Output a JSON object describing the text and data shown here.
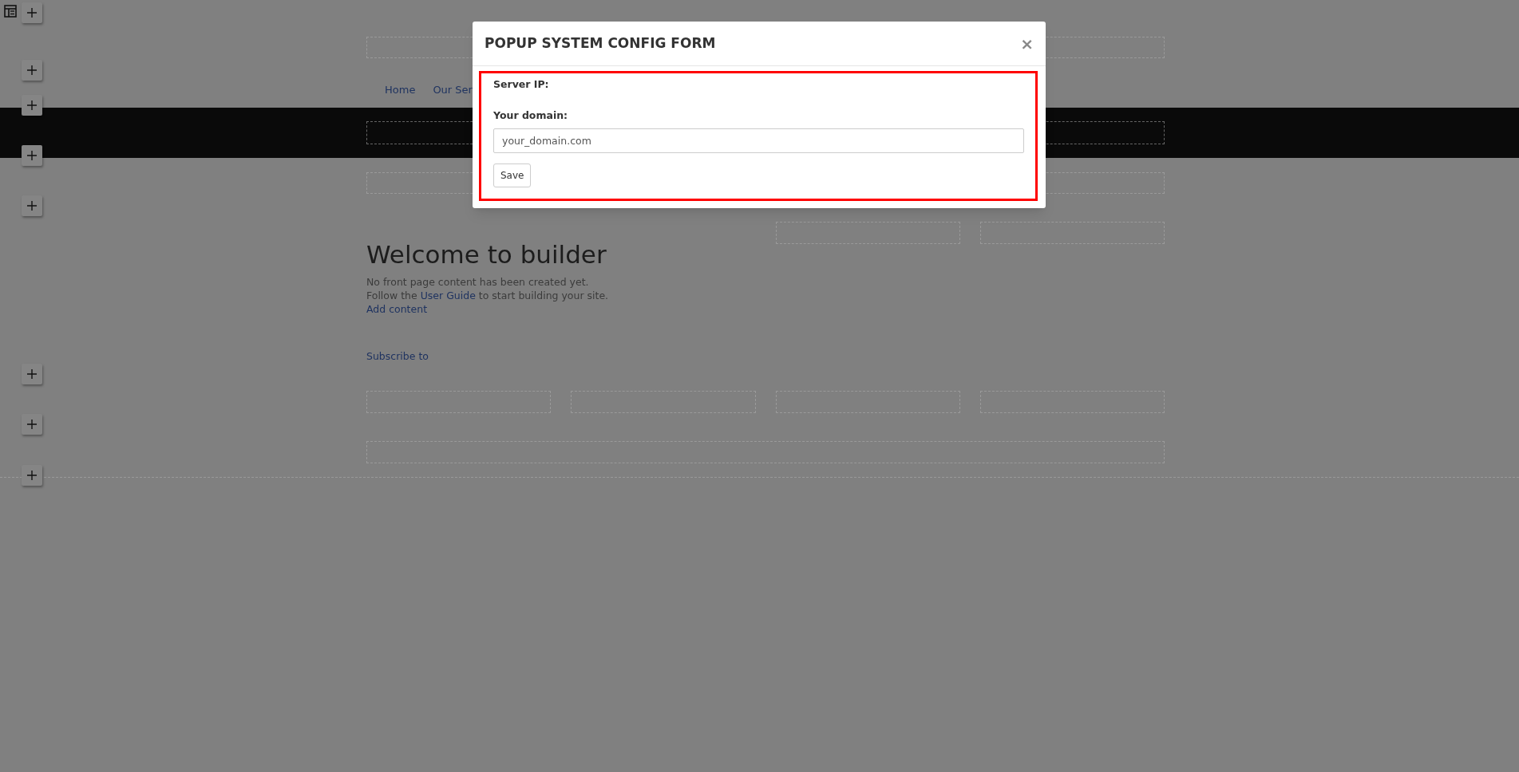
{
  "page": {
    "nav": [
      "Home",
      "Our Ser"
    ],
    "heading": "Welcome to builder",
    "intro": "No front page content has been created yet.",
    "guide_line": {
      "before": "Follow the ",
      "link": "User Guide",
      "after": " to start building your site."
    },
    "add_content": "Add content",
    "subscribe": "Subscribe to"
  },
  "modal": {
    "title": "POPUP SYSTEM CONFIG FORM",
    "close": "×",
    "fields": [
      {
        "label": "Server IP:"
      },
      {
        "label": "Your domain:",
        "value": "your_domain.com"
      }
    ],
    "save": "Save"
  }
}
